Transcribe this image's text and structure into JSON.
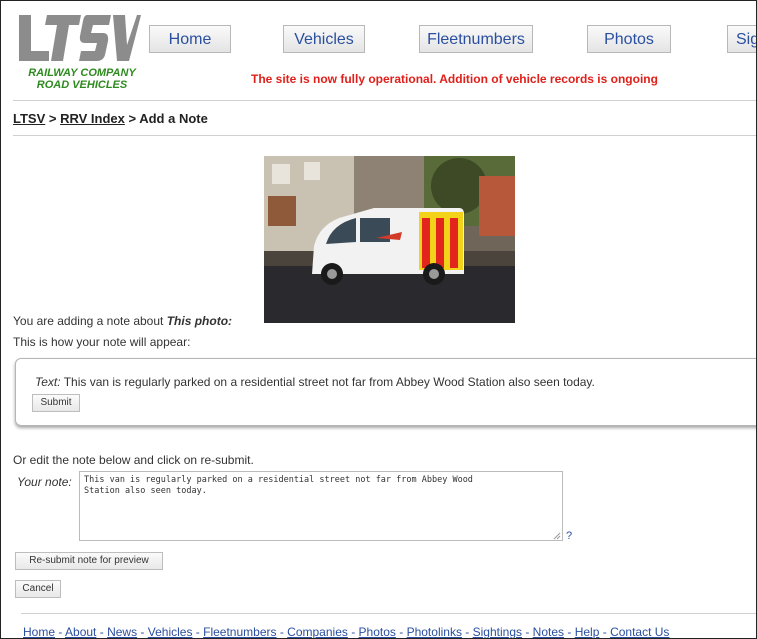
{
  "logo": {
    "subtitle_line1": "RAILWAY COMPANY",
    "subtitle_line2": "ROAD VEHICLES"
  },
  "nav": {
    "home": "Home",
    "vehicles": "Vehicles",
    "fleetnumbers": "Fleetnumbers",
    "photos": "Photos",
    "sightings": "Sigh"
  },
  "banner": "The site is now fully operational. Addition of vehicle records is ongoing",
  "breadcrumb": {
    "root": "LTSV",
    "sep1": " > ",
    "index": "RRV Index",
    "sep2": " > ",
    "current": "Add a Note"
  },
  "intro": {
    "prefix": "You are adding a note about ",
    "subject": "This photo:"
  },
  "preview_heading": "This is how your note will appear:",
  "preview": {
    "label": "Text:",
    "text": " This van is regularly parked on a residential street not far from Abbey Wood Station also seen today.",
    "submit": "Submit"
  },
  "edit_instructions": "Or edit the note below and click on re-submit.",
  "note": {
    "label": "Your note:",
    "value": "This van is regularly parked on a residential street not far from Abbey Wood\nStation also seen today.",
    "help": "?"
  },
  "buttons": {
    "resubmit": "Re-submit note for preview",
    "cancel": "Cancel"
  },
  "footer": {
    "links": [
      "Home",
      "About",
      "News",
      "Vehicles",
      "Fleetnumbers",
      "Companies",
      "Photos",
      "Photolinks",
      "Sightings",
      "Notes",
      "Help",
      "Contact Us"
    ],
    "separator": " - "
  },
  "colors": {
    "nav_text": "#2a4fa0",
    "banner": "#e0201a",
    "logo_green": "#2e8b1f",
    "logo_grey": "#8a8a8a"
  }
}
